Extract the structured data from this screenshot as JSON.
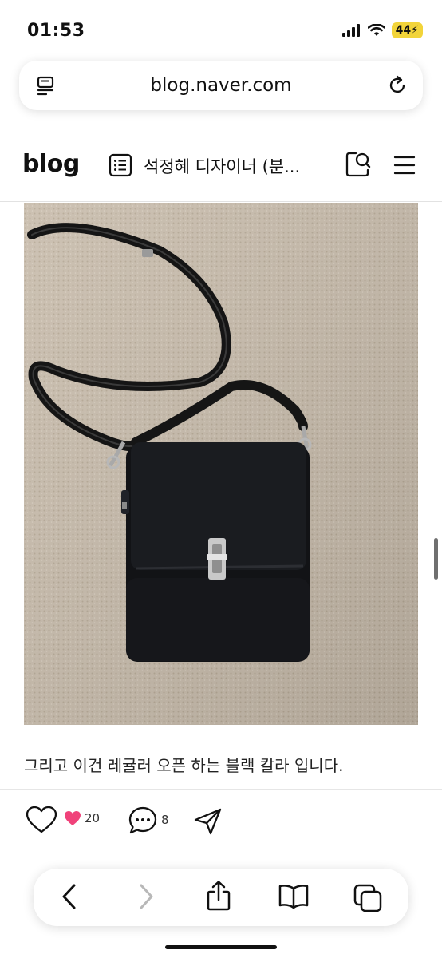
{
  "status_bar": {
    "time": "01:53",
    "battery": "44",
    "icons": [
      "cellular-signal-icon",
      "wifi-icon",
      "battery-charging-icon"
    ]
  },
  "browser": {
    "url": "blog.naver.com",
    "icons": [
      "reader-icon",
      "reload-icon"
    ]
  },
  "blog_header": {
    "logo": "blog",
    "title": "석정혜 디자이너 (분...",
    "icons": [
      "post-list-icon",
      "search-icon",
      "menu-icon"
    ]
  },
  "post": {
    "image_alt": "black leather crossbody bag with strap on beige carpet",
    "caption": "그리고 이건 레귤러 오픈 하는 블랙 칼라 입니다."
  },
  "actions": {
    "like_count": "20",
    "comment_count": "8"
  },
  "toolbar": {
    "icons": [
      "back-icon",
      "forward-icon",
      "share-icon",
      "bookmarks-icon",
      "tabs-icon"
    ]
  },
  "colors": {
    "battery": "#f2d43a",
    "like_heart": "#f0427a",
    "text": "#111111"
  }
}
